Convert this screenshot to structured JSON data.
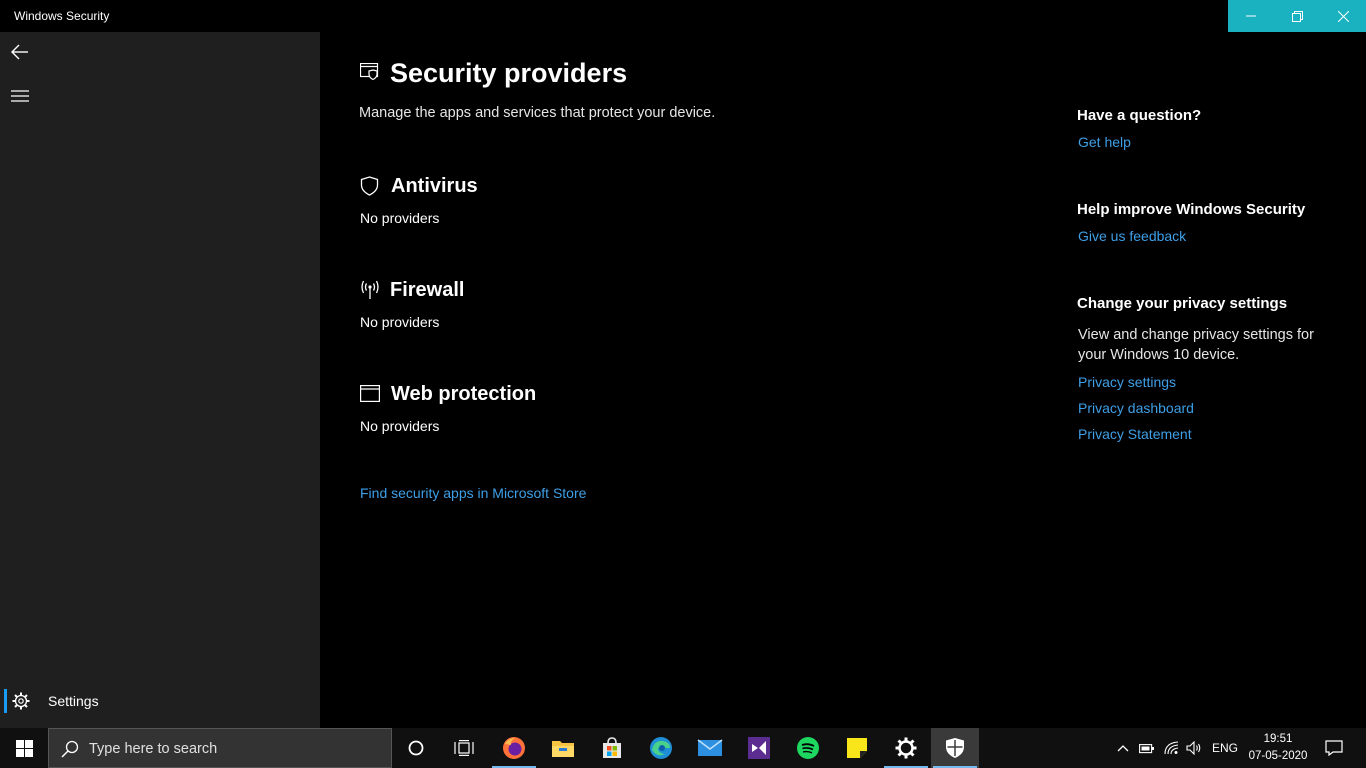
{
  "window": {
    "title": "Windows Security"
  },
  "sidebar": {
    "settings_label": "Settings"
  },
  "main": {
    "title": "Security providers",
    "subtitle": "Manage the apps and services that protect your device.",
    "sections": [
      {
        "title": "Antivirus",
        "status": "No providers",
        "icon": "shield-icon"
      },
      {
        "title": "Firewall",
        "status": "No providers",
        "icon": "wifi-broadcast-icon"
      },
      {
        "title": "Web protection",
        "status": "No providers",
        "icon": "browser-window-icon"
      }
    ],
    "store_link": "Find security apps in Microsoft Store"
  },
  "right": {
    "question_heading": "Have a question?",
    "get_help": "Get help",
    "improve_heading": "Help improve Windows Security",
    "feedback": "Give us feedback",
    "privacy_heading": "Change your privacy settings",
    "privacy_text": "View and change privacy settings for your Windows 10 device.",
    "privacy_settings": "Privacy settings",
    "privacy_dashboard": "Privacy dashboard",
    "privacy_statement": "Privacy Statement"
  },
  "taskbar": {
    "search_placeholder": "Type here to search",
    "apps": [
      "firefox-icon",
      "file-explorer-icon",
      "store-icon",
      "edge-icon",
      "mail-icon",
      "visual-studio-icon",
      "spotify-icon",
      "sticky-notes-icon",
      "settings-icon",
      "windows-security-icon"
    ],
    "language": "ENG",
    "time": "19:51",
    "date": "07-05-2020"
  },
  "colors": {
    "accent": "#1ab1c0",
    "link": "#3e9fe6",
    "sidebar": "#1f1f1f",
    "background": "#000000"
  }
}
